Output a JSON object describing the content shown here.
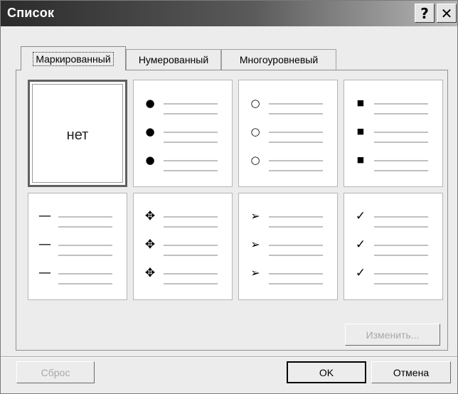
{
  "window": {
    "title": "Список"
  },
  "titlebar": {
    "help_label": "?",
    "close_label": "✕"
  },
  "tabs": [
    {
      "label": "Маркированный",
      "active": true
    },
    {
      "label": "Нумерованный",
      "active": false
    },
    {
      "label": "Многоуровневый",
      "active": false
    }
  ],
  "gallery": {
    "none_label": "нет",
    "styles": [
      {
        "name": "none"
      },
      {
        "name": "filled-circle",
        "glyph": "●"
      },
      {
        "name": "hollow-circle",
        "glyph": "○"
      },
      {
        "name": "square",
        "glyph": "■"
      },
      {
        "name": "dash",
        "glyph": "—"
      },
      {
        "name": "four-diamonds",
        "glyph": "✥"
      },
      {
        "name": "arrowhead",
        "glyph": "➢"
      },
      {
        "name": "checkmark",
        "glyph": "✓"
      }
    ]
  },
  "buttons": {
    "modify": "Изменить...",
    "reset": "Сброс",
    "ok": "OK",
    "cancel": "Отмена"
  }
}
